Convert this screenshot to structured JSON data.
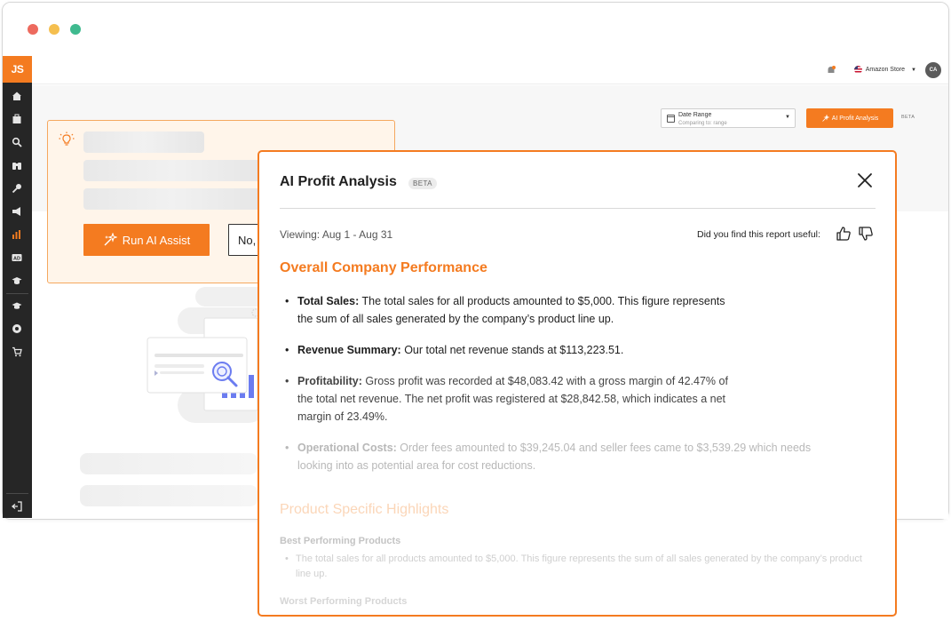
{
  "app": {
    "logo": "JS"
  },
  "topbar": {
    "store_label": "Amazon Store",
    "avatar_initials": "CA"
  },
  "toolbar": {
    "date_range_label": "Date Range",
    "date_range_sub": "Comparing to: range",
    "ai_button_label": "AI Profit Analysis",
    "beta_label": "BETA"
  },
  "assist_card": {
    "run_label": "Run AI Assist",
    "no_label": "No,"
  },
  "modal": {
    "title": "AI Profit Analysis",
    "beta": "BETA",
    "viewing": "Viewing: Aug 1 - Aug 31",
    "feedback_question": "Did you find this report useful:",
    "section1_title": "Overall Company Performance",
    "bullets": [
      {
        "label": "Total Sales:",
        "text": " The total sales for all products amounted to $5,000. This figure represents the sum of all sales generated by the company’s product line up."
      },
      {
        "label": "Revenue Summary:",
        "text": " Our total net revenue stands at $113,223.51."
      },
      {
        "label": "Profitability:",
        "text": " Gross profit was recorded at $48,083.42 with a gross margin of 42.47% of the total net revenue. The net profit was registered at $28,842.58, which indicates a net margin of 23.49%."
      },
      {
        "label": "Operational Costs:",
        "text": " Order fees amounted to $39,245.04 and seller fees came to $3,539.29 which needs looking into as potential area for cost reductions."
      }
    ],
    "section2_title": "Product Specific Highlights",
    "best_heading": "Best Performing Products",
    "best_text": "The total sales for all products amounted to $5,000. This figure represents the sum of all sales generated by the company’s product line up.",
    "worst_heading": "Worst Performing Products"
  },
  "colors": {
    "accent": "#f47b20",
    "sidebar": "#262626"
  }
}
